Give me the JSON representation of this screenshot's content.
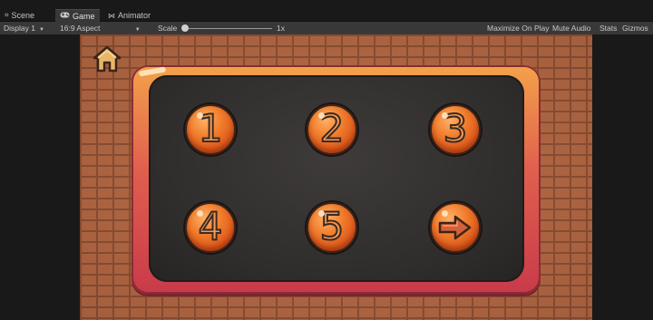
{
  "tabs": [
    {
      "label": "Scene",
      "icon": "grid-icon",
      "active": false
    },
    {
      "label": "Game",
      "icon": "gamepad-icon",
      "active": true
    },
    {
      "label": "Animator",
      "icon": "animator-icon",
      "active": false
    }
  ],
  "toolbar": {
    "display": "Display 1",
    "aspect": "16:9 Aspect",
    "scale_label": "Scale",
    "scale_value": "1x",
    "maximize": "Maximize On Play",
    "mute": "Mute Audio",
    "stats": "Stats",
    "gizmos": "Gizmos"
  },
  "game": {
    "home_icon": "home-icon",
    "levels": [
      {
        "label": "1"
      },
      {
        "label": "2"
      },
      {
        "label": "3"
      },
      {
        "label": "4"
      },
      {
        "label": "5"
      }
    ],
    "next_icon": "arrow-right-icon",
    "colors": {
      "brick": "#b56a46",
      "mortar": "#8a4e34",
      "panel_frame_top": "#f3a24a",
      "panel_frame_bottom": "#c93a4a",
      "panel_inner": "#2f2d2c",
      "button_orange": "#f07a2a"
    }
  }
}
